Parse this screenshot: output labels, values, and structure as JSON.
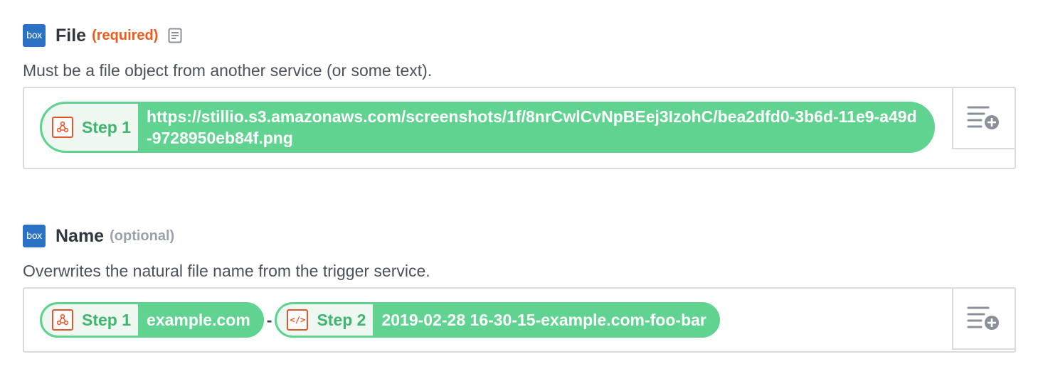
{
  "fields": {
    "file": {
      "label": "File",
      "badge": "(required)",
      "logo": "box",
      "description": "Must be a file object from another service (or some text).",
      "pill": {
        "step_label": "Step 1",
        "step_icon": "webhook-icon",
        "value": "https://stillio.s3.amazonaws.com/screenshots/1f/8nrCwlCvNpBEej3IzohC/bea2dfd0-3b6d-11e9-a49d-9728950eb84f.png"
      }
    },
    "name": {
      "label": "Name",
      "badge": "(optional)",
      "logo": "box",
      "description": "Overwrites the natural file name from the trigger service.",
      "pill1": {
        "step_label": "Step 1",
        "step_icon": "webhook-icon",
        "value": "example.com"
      },
      "separator": "-",
      "pill2": {
        "step_label": "Step 2",
        "step_icon": "code-icon",
        "step_icon_text": "</>",
        "value": "2019-02-28 16-30-15-example.com-foo-bar"
      }
    }
  },
  "colors": {
    "pill_green": "#5fd38f",
    "step_text_green": "#3fb56f",
    "required_orange": "#f05a1a",
    "box_blue": "#2a72c4"
  }
}
